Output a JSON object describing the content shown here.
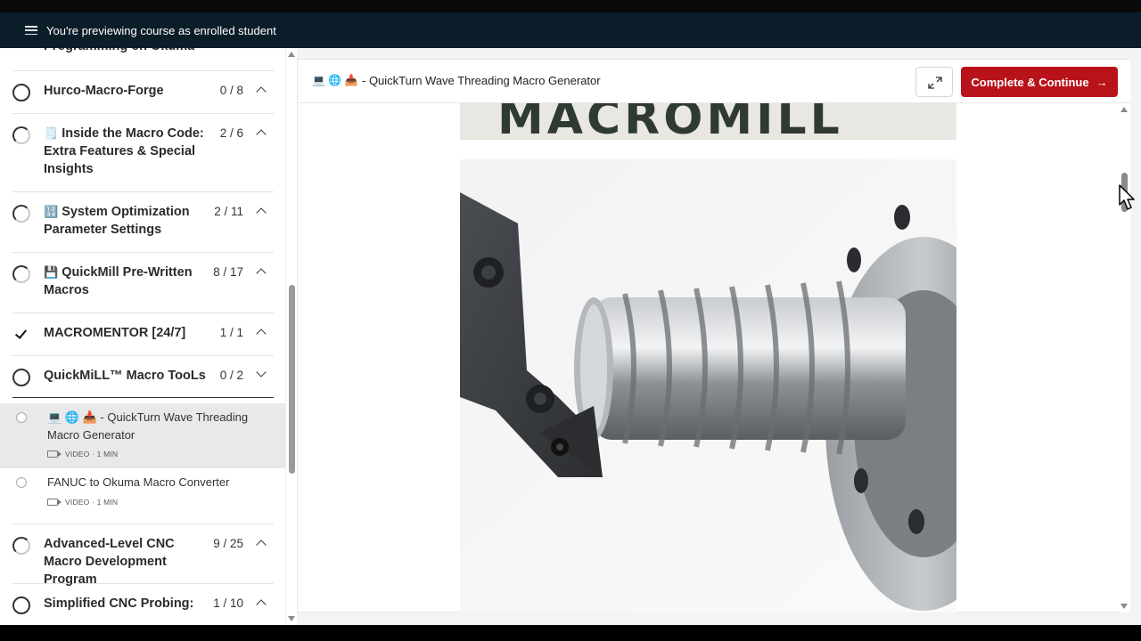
{
  "banner": {
    "text": "You're previewing course as enrolled student"
  },
  "sidebar": {
    "partial_top_label": "Programming on Okuma",
    "sections": [
      {
        "title": "Hurco-Macro-Forge",
        "count": "0 / 8",
        "state": "empty",
        "emoji": ""
      },
      {
        "title": "Inside the Macro Code: Extra Features & Special Insights",
        "count": "2 / 6",
        "state": "partial",
        "emoji": "🗒️"
      },
      {
        "title": "System Optimization Parameter Settings",
        "count": "2 / 11",
        "state": "partial",
        "emoji": "🔢"
      },
      {
        "title": "QuickMill Pre-Written Macros",
        "count": "8 / 17",
        "state": "partial",
        "emoji": "💾"
      },
      {
        "title": "MACROMENTOR [24/7]",
        "count": "1 / 1",
        "state": "complete",
        "emoji": ""
      },
      {
        "title": "QuickMiLL™ Macro TooLs",
        "count": "0 / 2",
        "state": "empty",
        "emoji": ""
      },
      {
        "title": "Advanced-Level CNC Macro Development Program",
        "count": "9 / 25",
        "state": "partial",
        "emoji": ""
      },
      {
        "title": "Simplified CNC Probing:",
        "count": "1 / 10",
        "state": "empty",
        "emoji": ""
      }
    ],
    "lessons": [
      {
        "emoji": "💻 🌐 📥",
        "title": " - QuickTurn Wave Threading Macro Generator",
        "meta": "VIDEO · 1 MIN"
      },
      {
        "emoji": "",
        "title": "FANUC to Okuma Macro Converter",
        "meta": "VIDEO · 1 MIN"
      }
    ]
  },
  "header": {
    "icons": "💻 🌐 📥",
    "title": " - QuickTurn Wave Threading Macro Generator",
    "complete_label": "Complete & Continue",
    "complete_arrow": "→"
  },
  "viewer": {
    "logo_text": "MACROMILL"
  },
  "colors": {
    "accent": "#b8121b",
    "banner": "#0c1d2a"
  }
}
